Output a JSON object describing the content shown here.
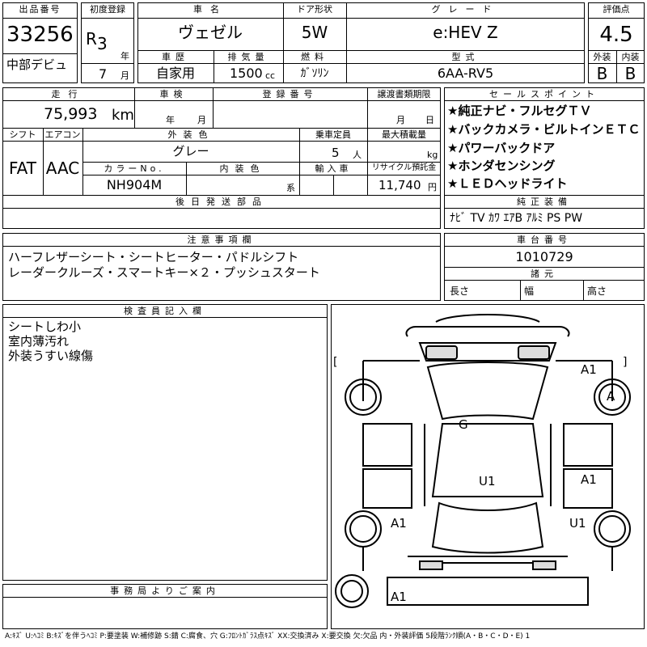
{
  "header": {
    "lot_no_label": "出品番号",
    "lot_no": "33256",
    "debut_label": "中部デビュ",
    "first_reg_label": "初度登録",
    "era": "R",
    "year": "3",
    "year_unit": "年",
    "month": "7",
    "month_unit": "月",
    "car_name_label": "車名",
    "car_name": "ヴェゼル",
    "door_label": "ドア形状",
    "door": "5W",
    "grade_label": "グレード",
    "grade": "e:HEV Z",
    "score_label": "評価点",
    "score": "4.5",
    "history_label": "車歴",
    "history": "自家用",
    "displacement_label": "排気量",
    "displacement": "1500",
    "displacement_unit": "cc",
    "fuel_label": "燃料",
    "fuel": "ｶﾞｿﾘﾝ",
    "model_label": "型式",
    "model": "6AA-RV5",
    "exterior_grade_label": "外装",
    "exterior_grade": "B",
    "interior_grade_label": "内装",
    "interior_grade": "B"
  },
  "specs": {
    "mileage_label": "走行",
    "mileage": "75,993",
    "mileage_unit": "km",
    "inspection_label": "車検",
    "inspection_year_unit": "年",
    "inspection_month_unit": "月",
    "reg_no_label": "登録番号",
    "transfer_label": "譲渡書類期限",
    "transfer_month_unit": "月",
    "transfer_day_unit": "日",
    "shift_label": "シフト",
    "shift": "FAT",
    "aircon_label": "エアコン",
    "aircon": "AAC",
    "ext_color_label": "外装色",
    "ext_color": "グレー",
    "capacity_label": "乗車定員",
    "capacity": "5",
    "capacity_unit": "人",
    "max_load_label": "最大積載量",
    "max_load_unit": "kg",
    "color_no_label": "カラーNo.",
    "color_no": "NH904M",
    "int_color_label": "内装色",
    "int_color_unit": "系",
    "import_label": "輸入車",
    "recycle_label": "リサイクル預託金",
    "recycle": "11,740",
    "recycle_unit": "円",
    "later_parts_label": "後日発送部品"
  },
  "sales_points": {
    "label": "セールスポイント",
    "items": [
      "★純正ナビ・フルセグＴＶ",
      "★バックカメラ・ビルトインＥＴＣ",
      "★パワーバックドア",
      "★ホンダセンシング",
      "★ＬＥＤヘッドライト"
    ]
  },
  "equipment": {
    "label": "純正装備",
    "value": "ﾅﾋﾞ TV ｶﾜ ｴｱB ｱﾙﾐ PS PW"
  },
  "notes": {
    "label": "注意事項欄",
    "lines": [
      "ハーフレザーシート・シートヒーター・パドルシフト",
      "レーダークルーズ・スマートキー×２・プッシュスタート"
    ]
  },
  "chassis": {
    "label": "車台番号",
    "value": "1010729",
    "dims_label": "諸元",
    "length_label": "長さ",
    "width_label": "幅",
    "height_label": "高さ"
  },
  "inspector": {
    "label": "検査員記入欄",
    "lines": [
      "シートしわ小",
      "室内薄汚れ",
      "外装うすい線傷"
    ]
  },
  "office": {
    "label": "事務局よりご案内"
  },
  "diagram_marks": {
    "a1_front_right": "A1",
    "a_front_right_wheel": "A",
    "g_windshield": "G",
    "u1_roof": "U1",
    "a1_right_rear_door": "A1",
    "a1_left_rear_wheel": "A1",
    "u1_right_rear_wheel": "U1",
    "a1_rear": "A1",
    "bracket_open": "[",
    "bracket_close": "]"
  },
  "legend": "A:ｷｽﾞ U:ﾍｺﾐ B:ｷｽﾞを伴うﾍｺﾐ P:要塗装 W:補修跡 S:錆 C:腐食、穴 G:ﾌﾛﾝﾄｶﾞﾗｽ点ｷｽﾞ XX:交換済み X:要交換 欠:欠品 内・外装評価 5段階ﾗﾝｸ順(A・B・C・D・E) 1"
}
